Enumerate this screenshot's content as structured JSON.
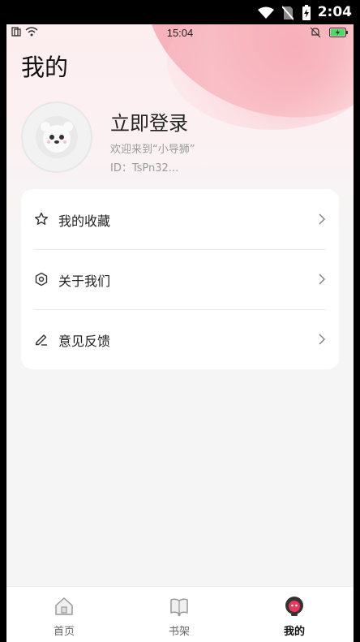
{
  "system_status": {
    "time": "2:04"
  },
  "app_status": {
    "time": "15:04"
  },
  "page": {
    "title": "我的"
  },
  "profile": {
    "login_label": "立即登录",
    "welcome_text": "欢迎来到“小导狮”",
    "id_text": "ID：TsPn32..."
  },
  "menu": {
    "items": [
      {
        "label": "我的收藏",
        "icon": "star-icon"
      },
      {
        "label": "关于我们",
        "icon": "hexagon-icon"
      },
      {
        "label": "意见反馈",
        "icon": "pencil-icon"
      }
    ]
  },
  "tabbar": {
    "tabs": [
      {
        "label": "首页",
        "icon": "home-icon",
        "active": false
      },
      {
        "label": "书架",
        "icon": "book-icon",
        "active": false
      },
      {
        "label": "我的",
        "icon": "mascot-icon",
        "active": true
      }
    ]
  },
  "colors": {
    "accent": "#e8375b",
    "hero_pink": "#f6a6b1"
  }
}
